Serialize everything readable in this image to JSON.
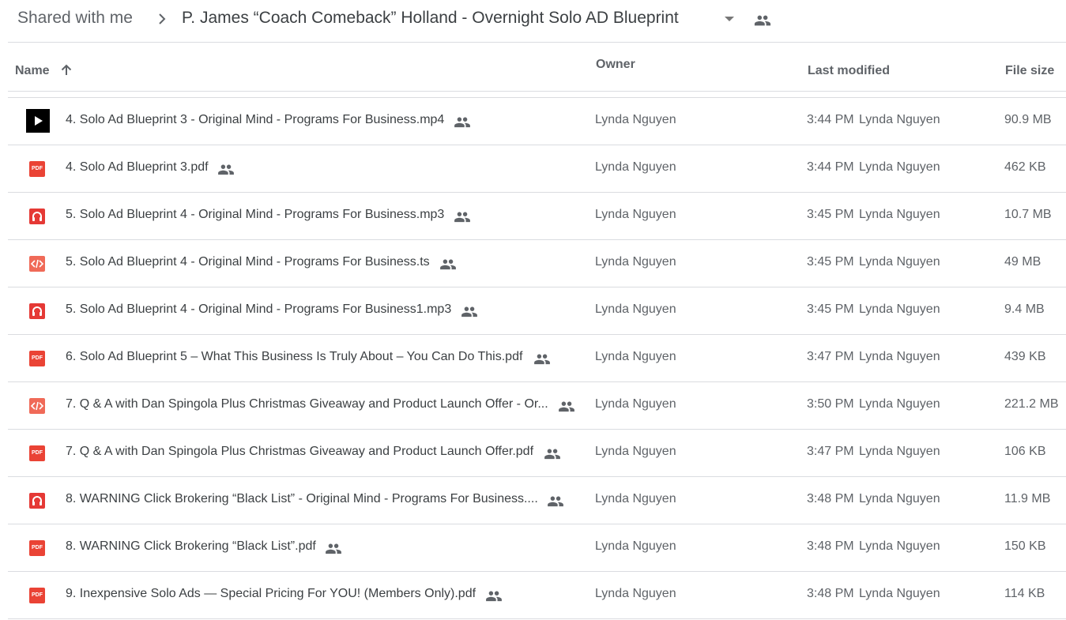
{
  "breadcrumb": {
    "root": "Shared with me",
    "current": "P. James “Coach Comeback” Holland - Overnight Solo AD Blueprint"
  },
  "columns": {
    "name": "Name",
    "owner": "Owner",
    "modified": "Last modified",
    "size": "File size"
  },
  "colors": {
    "pdf": "#ea4335",
    "audio": "#e53935",
    "code": "#f06a58",
    "video": "#000000",
    "text": "#3c4043",
    "muted": "#5f6368"
  },
  "files": [
    {
      "type": "video-icon",
      "name": "4. Solo Ad Blueprint 3 - Original Mind - Programs For Business.mp4",
      "owner": "Lynda Nguyen",
      "time": "3:44 PM",
      "by": "Lynda Nguyen",
      "size": "90.9 MB"
    },
    {
      "type": "pdf-icon",
      "name": "4. Solo Ad Blueprint 3.pdf",
      "owner": "Lynda Nguyen",
      "time": "3:44 PM",
      "by": "Lynda Nguyen",
      "size": "462 KB"
    },
    {
      "type": "audio-icon",
      "name": "5. Solo Ad Blueprint 4 - Original Mind - Programs For Business.mp3",
      "owner": "Lynda Nguyen",
      "time": "3:45 PM",
      "by": "Lynda Nguyen",
      "size": "10.7 MB"
    },
    {
      "type": "code-icon",
      "name": "5. Solo Ad Blueprint 4 - Original Mind - Programs For Business.ts",
      "owner": "Lynda Nguyen",
      "time": "3:45 PM",
      "by": "Lynda Nguyen",
      "size": "49 MB"
    },
    {
      "type": "audio-icon",
      "name": "5. Solo Ad Blueprint 4 - Original Mind - Programs For Business1.mp3",
      "owner": "Lynda Nguyen",
      "time": "3:45 PM",
      "by": "Lynda Nguyen",
      "size": "9.4 MB"
    },
    {
      "type": "pdf-icon",
      "name": "6. Solo Ad Blueprint 5 – What This Business Is Truly About – You Can Do This.pdf",
      "owner": "Lynda Nguyen",
      "time": "3:47 PM",
      "by": "Lynda Nguyen",
      "size": "439 KB"
    },
    {
      "type": "code-icon",
      "name": "7. Q & A with Dan Spingola Plus Christmas Giveaway and Product Launch Offer - Or...",
      "owner": "Lynda Nguyen",
      "time": "3:50 PM",
      "by": "Lynda Nguyen",
      "size": "221.2 MB"
    },
    {
      "type": "pdf-icon",
      "name": "7. Q & A with Dan Spingola Plus Christmas Giveaway and Product Launch Offer.pdf",
      "owner": "Lynda Nguyen",
      "time": "3:47 PM",
      "by": "Lynda Nguyen",
      "size": "106 KB"
    },
    {
      "type": "audio-icon",
      "name": "8. WARNING Click Brokering “Black List” - Original Mind - Programs For Business....",
      "owner": "Lynda Nguyen",
      "time": "3:48 PM",
      "by": "Lynda Nguyen",
      "size": "11.9 MB"
    },
    {
      "type": "pdf-icon",
      "name": "8. WARNING Click Brokering “Black List”.pdf",
      "owner": "Lynda Nguyen",
      "time": "3:48 PM",
      "by": "Lynda Nguyen",
      "size": "150 KB"
    },
    {
      "type": "pdf-icon",
      "name": "9. Inexpensive Solo Ads — Special Pricing For YOU! (Members Only).pdf",
      "owner": "Lynda Nguyen",
      "time": "3:48 PM",
      "by": "Lynda Nguyen",
      "size": "114 KB"
    }
  ]
}
